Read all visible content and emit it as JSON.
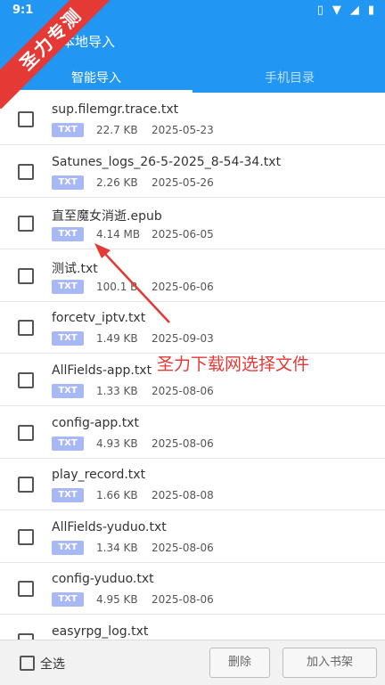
{
  "status_bar": {
    "time": "9:1",
    "icons": [
      "vibrate-icon",
      "wifi-icon",
      "signal-icon",
      "battery-icon"
    ]
  },
  "header": {
    "title": "本地导入",
    "tabs": [
      {
        "label": "智能导入",
        "active": true
      },
      {
        "label": "手机目录",
        "active": false
      }
    ]
  },
  "watermark": {
    "text": "圣力专测"
  },
  "files": [
    {
      "name": "sup.filemgr.trace.txt",
      "type": "TXT",
      "size": "22.7 KB",
      "date": "2025-05-23"
    },
    {
      "name": "Satunes_logs_26-5-2025_8-54-34.txt",
      "type": "TXT",
      "size": "2.26 KB",
      "date": "2025-05-26"
    },
    {
      "name": "直至魔女消逝.epub",
      "type": "TXT",
      "size": "4.14 MB",
      "date": "2025-06-05"
    },
    {
      "name": "测试.txt",
      "type": "TXT",
      "size": "100.1 B",
      "date": "2025-06-06"
    },
    {
      "name": "forcetv_iptv.txt",
      "type": "TXT",
      "size": "1.49 KB",
      "date": "2025-09-03"
    },
    {
      "name": "AllFields-app.txt",
      "type": "TXT",
      "size": "1.33 KB",
      "date": "2025-08-06"
    },
    {
      "name": "config-app.txt",
      "type": "TXT",
      "size": "4.93 KB",
      "date": "2025-08-06"
    },
    {
      "name": "play_record.txt",
      "type": "TXT",
      "size": "1.66 KB",
      "date": "2025-08-08"
    },
    {
      "name": "AllFields-yuduo.txt",
      "type": "TXT",
      "size": "1.34 KB",
      "date": "2025-08-06"
    },
    {
      "name": "config-yuduo.txt",
      "type": "TXT",
      "size": "4.95 KB",
      "date": "2025-08-06"
    },
    {
      "name": "easyrpg_log.txt",
      "type": "",
      "size": "",
      "date": ""
    }
  ],
  "annotation": {
    "text": "圣力下载网选择文件",
    "color": "#e53935"
  },
  "bottom_bar": {
    "select_all": "全选",
    "delete": "删除",
    "add_to_shelf": "加入书架"
  },
  "colors": {
    "primary": "#2196f3",
    "badge": "#a7b8f5",
    "annotation": "#e53935"
  }
}
